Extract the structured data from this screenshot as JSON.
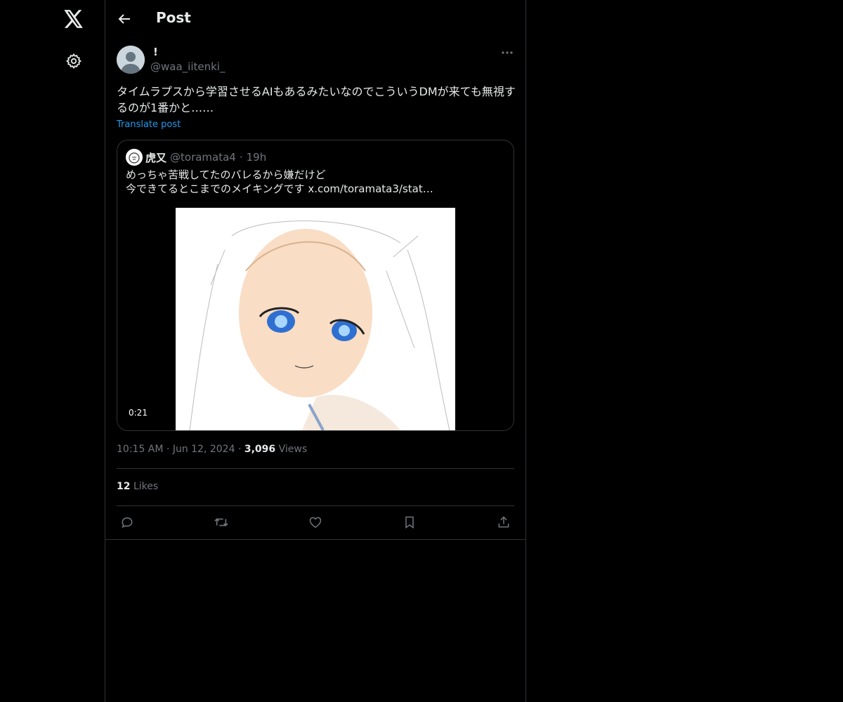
{
  "header": {
    "title": "Post"
  },
  "nav": {
    "icons": [
      "x-logo-icon",
      "gear-icon"
    ]
  },
  "post": {
    "author_name": "!",
    "author_handle": "@waa_iitenki_",
    "text": "タイムラプスから学習させるAIもあるみたいなのでこういうDMが来ても無視するのが1番かと……",
    "translate_label": "Translate post",
    "time": "10:15 AM",
    "date": "Jun 12, 2024",
    "views_count": "3,096",
    "views_label": "Views",
    "likes_count": "12",
    "likes_label": "Likes",
    "separator": "·"
  },
  "quote": {
    "name": "虎又",
    "handle": "@toramata4",
    "separator": "·",
    "time": "19h",
    "text_line1": "めっちゃ苦戦してたのバレるから嫌だけど",
    "text_line2": "今できてるとこまでのメイキングです ",
    "link": "x.com/toramata3/stat…",
    "video_duration": "0:21"
  },
  "actions": [
    "reply-icon",
    "repost-icon",
    "like-icon",
    "bookmark-icon",
    "share-icon"
  ],
  "colors": {
    "background": "#000000",
    "text": "#e7e9ea",
    "muted": "#71767b",
    "accent": "#1d9bf0",
    "border": "#2f3336"
  }
}
